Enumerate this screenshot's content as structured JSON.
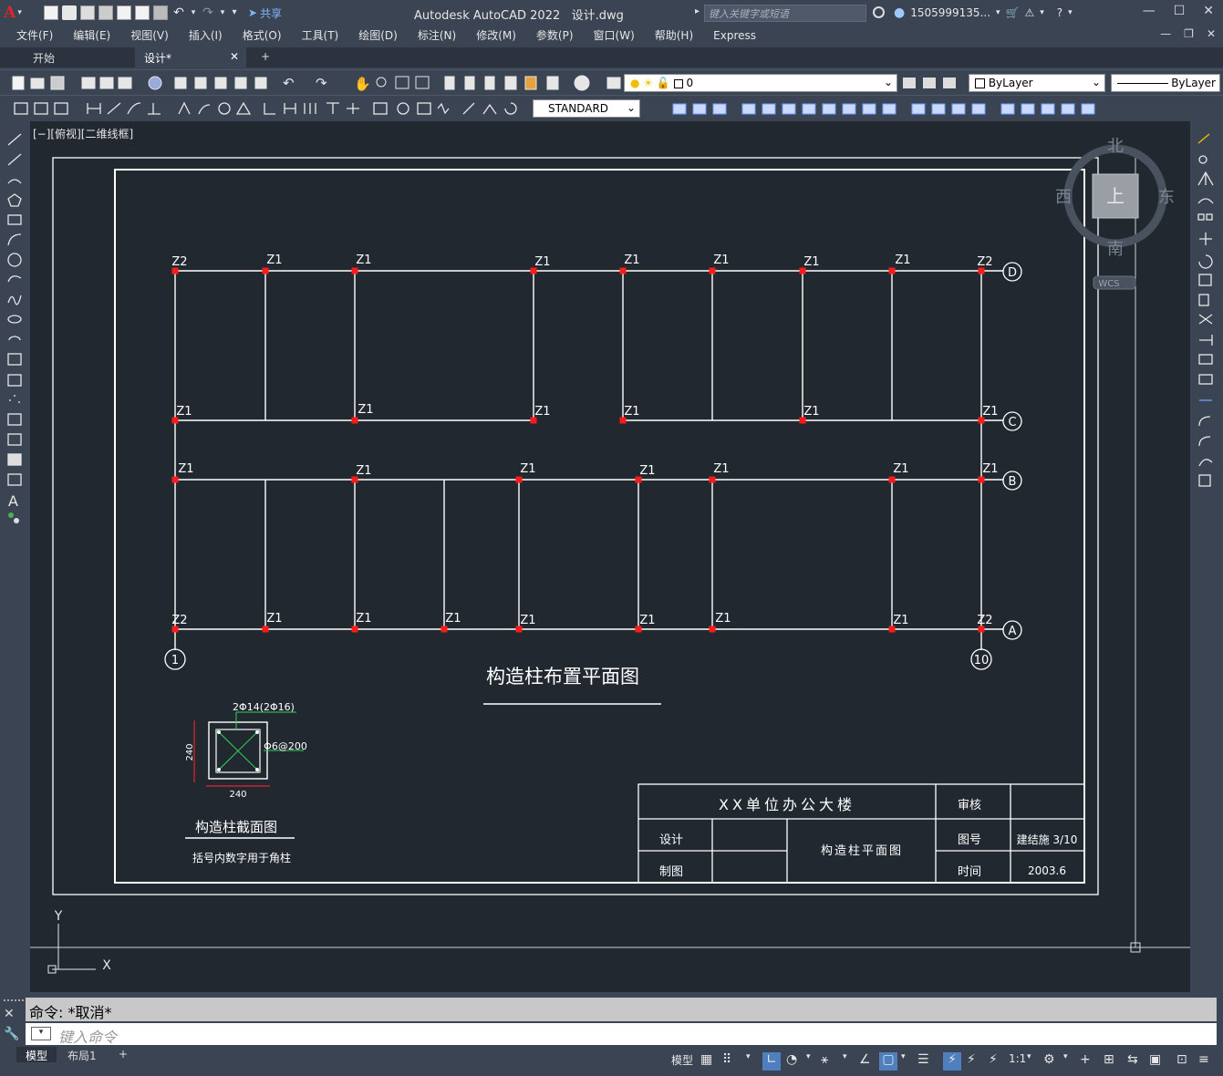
{
  "app": {
    "logo": "A",
    "title": "Autodesk AutoCAD 2022",
    "file": "设计.dwg",
    "share": "共享",
    "search_placeholder": "键入关键字或短语",
    "user": "1505999135..."
  },
  "menu": [
    "文件(F)",
    "编辑(E)",
    "视图(V)",
    "插入(I)",
    "格式(O)",
    "工具(T)",
    "绘图(D)",
    "标注(N)",
    "修改(M)",
    "参数(P)",
    "窗口(W)",
    "帮助(H)",
    "Express"
  ],
  "tabs": {
    "start": "开始",
    "design": "设计*",
    "add": "+"
  },
  "toolbar": {
    "layer_value": "0",
    "color_value": "ByLayer",
    "linetype_value": "ByLayer",
    "textstyle_value": "STANDARD"
  },
  "viewport": {
    "label": "[−][俯视][二维线框]"
  },
  "viewcube": {
    "north": "北",
    "south": "南",
    "east": "东",
    "west": "西",
    "top": "上",
    "wcs": "WCS"
  },
  "drawing": {
    "plan_title": "构造柱布置平面图",
    "axes_row": [
      "D",
      "C",
      "B",
      "A"
    ],
    "axes_col": [
      "1",
      "10"
    ],
    "section_title": "构造柱截面图",
    "section_note": "括号内数字用于角柱",
    "section_rebar": "2Φ14(2Φ16)",
    "section_stirrup": "Φ6@200",
    "section_w": "240",
    "section_h": "240",
    "titleblock": {
      "project": "XX单位办公大楼",
      "review": "审核",
      "design": "设计",
      "drawn": "制图",
      "drawing_name": "构造柱平面图",
      "no_label": "图号",
      "no_value": "建结施  3/10",
      "date_label": "时间",
      "date_value": "2003.6"
    },
    "col_z1": "Z1",
    "col_z2": "Z2",
    "ucs_x": "X",
    "ucs_y": "Y"
  },
  "command": {
    "last": "命令:  *取消*",
    "prompt": "键入命令"
  },
  "status": {
    "model": "模型",
    "layout1": "布局1",
    "add": "+",
    "model_btn": "模型",
    "scale": "1:1"
  }
}
